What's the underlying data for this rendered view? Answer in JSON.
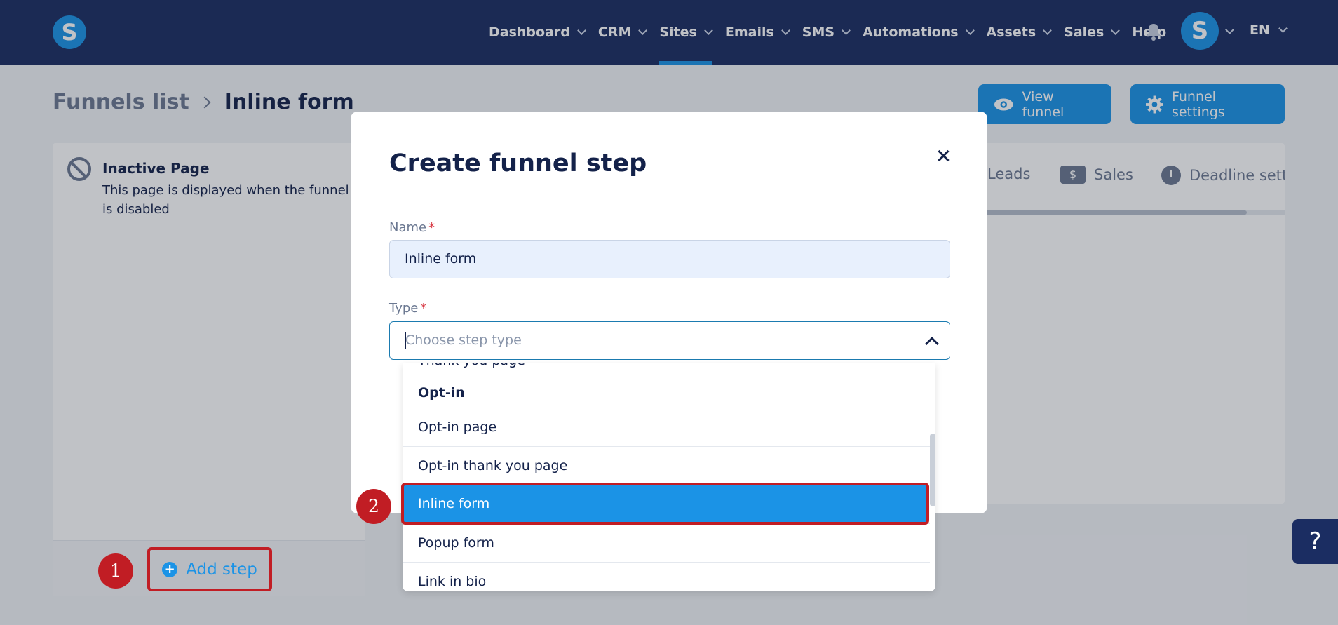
{
  "header": {
    "logo": "S",
    "nav": [
      {
        "label": "Dashboard"
      },
      {
        "label": "CRM"
      },
      {
        "label": "Sites"
      },
      {
        "label": "Emails"
      },
      {
        "label": "SMS"
      },
      {
        "label": "Automations"
      },
      {
        "label": "Assets"
      },
      {
        "label": "Sales"
      },
      {
        "label": "Help"
      }
    ],
    "active_nav": "Sites",
    "avatar": "S",
    "language": "EN"
  },
  "page": {
    "breadcrumb_root": "Funnels list",
    "breadcrumb_current": "Inline form",
    "view_funnel_label": "View funnel",
    "funnel_settings_label": "Funnel settings"
  },
  "left_panel": {
    "inactive_title": "Inactive Page",
    "inactive_desc": "This page is displayed when the funnel is disabled",
    "add_step_label": "Add step"
  },
  "right_panel": {
    "tabs": [
      {
        "label": "Leads"
      },
      {
        "label": "Sales",
        "icon": "$"
      },
      {
        "label": "Deadline setti"
      }
    ]
  },
  "modal": {
    "title": "Create funnel step",
    "name_label": "Name",
    "name_value": "Inline form",
    "type_label": "Type",
    "required_mark": "*",
    "type_placeholder": "Choose step type"
  },
  "dropdown": {
    "partial_item": "Thank you page",
    "group": "Opt-in",
    "items": [
      {
        "label": "Opt-in page"
      },
      {
        "label": "Opt-in thank you page"
      },
      {
        "label": "Inline form",
        "selected": true
      },
      {
        "label": "Popup form"
      },
      {
        "label": "Link in bio"
      }
    ]
  },
  "annotations": {
    "badge_1": "1",
    "badge_2": "2",
    "highlight_color": "#c11d24"
  },
  "help_label": "?"
}
